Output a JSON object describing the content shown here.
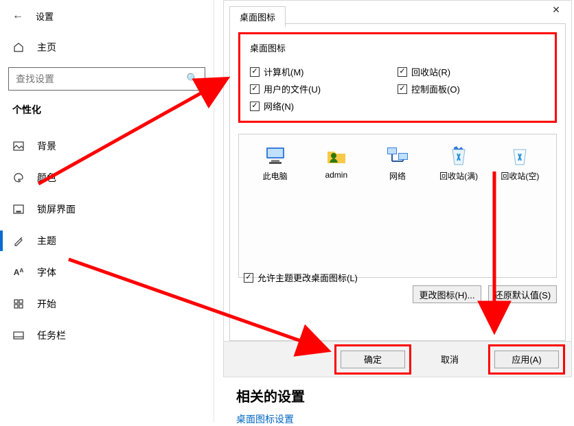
{
  "header": {
    "title": "设置"
  },
  "home": {
    "label": "主页"
  },
  "search": {
    "placeholder": "查找设置"
  },
  "section": "个性化",
  "sidebar": {
    "items": [
      {
        "label": "背景"
      },
      {
        "label": "颜色"
      },
      {
        "label": "锁屏界面"
      },
      {
        "label": "主题"
      },
      {
        "label": "字体"
      },
      {
        "label": "开始"
      },
      {
        "label": "任务栏"
      }
    ]
  },
  "dialog": {
    "tab": "桌面图标",
    "group_title": "桌面图标",
    "checks": {
      "computer": "计算机(M)",
      "recyclebin": "回收站(R)",
      "userfiles": "用户的文件(U)",
      "controlpanel": "控制面板(O)",
      "network": "网络(N)"
    },
    "preview": {
      "thispc": "此电脑",
      "user": "admin",
      "network": "网络",
      "binfull": "回收站(满)",
      "binempty": "回收站(空)"
    },
    "change_icon_btn": "更改图标(H)...",
    "restore_btn": "还原默认值(S)",
    "allow_theme": "允许主题更改桌面图标(L)",
    "ok": "确定",
    "cancel": "取消",
    "apply": "应用(A)"
  },
  "related": {
    "heading": "相关的设置",
    "link": "桌面图标设置"
  }
}
